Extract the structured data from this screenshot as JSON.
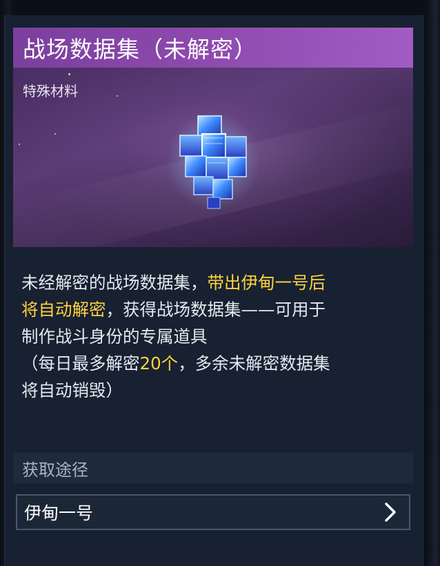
{
  "item": {
    "title": "战场数据集（未解密）",
    "category": "特殊材料",
    "icon": "encrypted-data-cube-icon",
    "header_color": "#8d49ad"
  },
  "description": {
    "line1_a": "未经解密的战场数据集，",
    "line1_b": "带出伊甸一号后",
    "line2_a": "将自动解密",
    "line2_b": "，获得战场数据集——可用于",
    "line3": "制作战斗身份的专属道具",
    "line4_a": "（每日最多解密",
    "line4_b": "20个",
    "line4_c": "，多余未解密数据集",
    "line5": "将自动销毁）",
    "highlight_color": "#ffd23d"
  },
  "acquisition": {
    "section_title": "获取途径",
    "sources": [
      {
        "label": "伊甸一号",
        "icon": "chevron-right-icon"
      }
    ]
  }
}
